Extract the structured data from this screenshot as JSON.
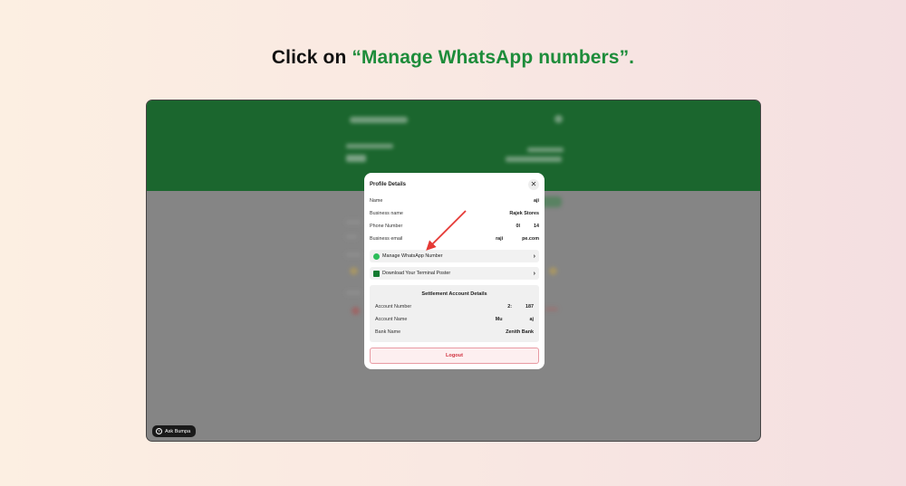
{
  "instruction": {
    "prefix": "Click on ",
    "highlight": "“Manage WhatsApp numbers”."
  },
  "modal": {
    "title": "Profile Details",
    "close_glyph": "✕",
    "fields": [
      {
        "label": "Name",
        "value": "aji"
      },
      {
        "label": "Business name",
        "value": "Rajek Stores"
      },
      {
        "label": "Phone Number",
        "value": "0I          14"
      },
      {
        "label": "Business email",
        "value": "raji              pe.com"
      }
    ],
    "manage_whatsapp_label": "Manage WhatsApp Number",
    "download_poster_label": "Download Your Terminal Poster",
    "chevron": "›",
    "settlement": {
      "title": "Settlement Account Details",
      "rows": [
        {
          "label": "Account Number",
          "value": "2:          187"
        },
        {
          "label": "Account Name",
          "value": "Mu                    aj"
        },
        {
          "label": "Bank Name",
          "value": "Zenith Bank"
        }
      ]
    },
    "logout_label": "Logout"
  },
  "ask_bumpa": {
    "label": "Ask Bumpa",
    "icon_glyph": "?"
  },
  "colors": {
    "brand_green": "#0e6a25",
    "highlight_green": "#1d8c3a",
    "logout_red": "#d1313f",
    "arrow_red": "#e53935"
  }
}
